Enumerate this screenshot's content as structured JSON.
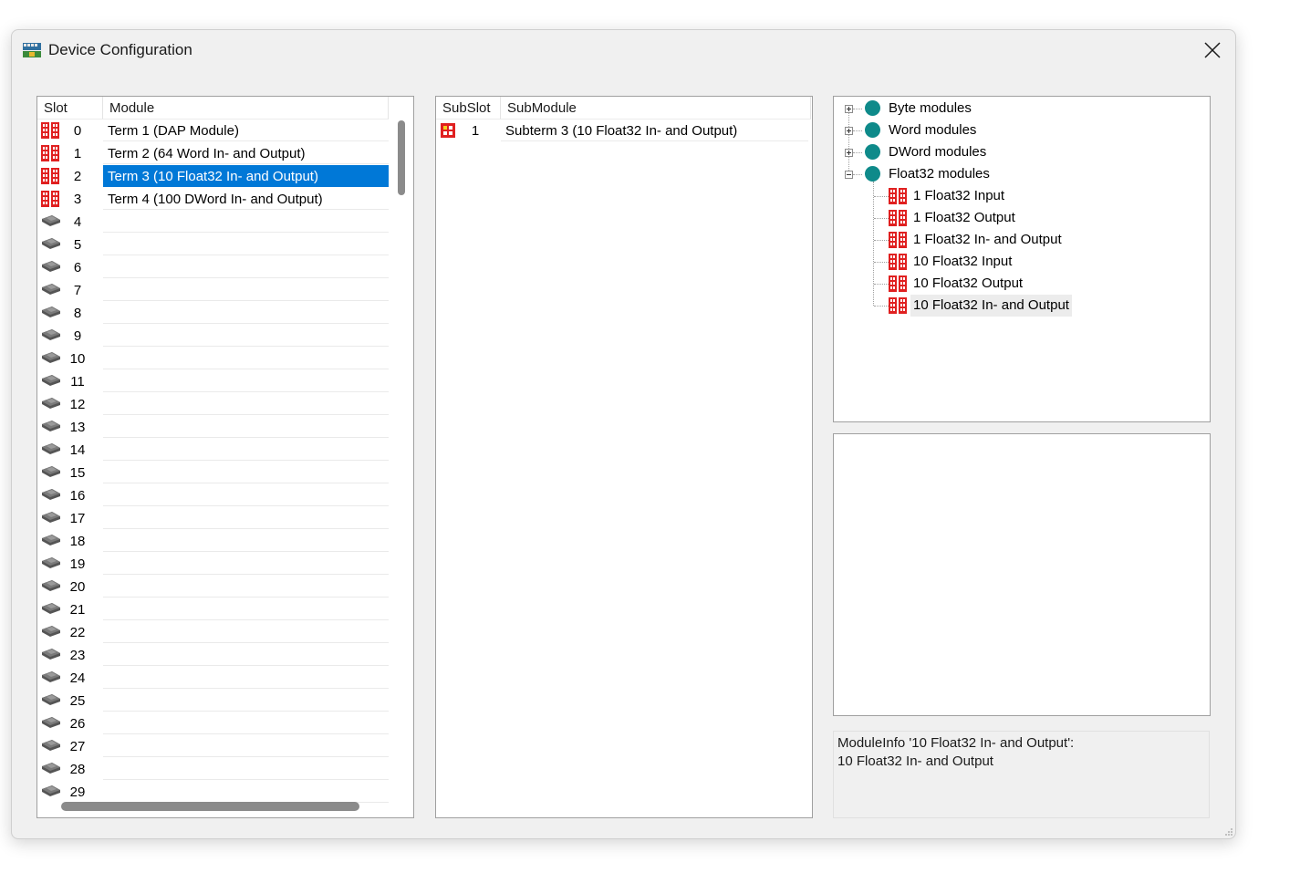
{
  "window": {
    "title": "Device Configuration"
  },
  "colors": {
    "accent": "#0078d7",
    "module_red": "#e02020",
    "tree_dot": "#0e8a8a"
  },
  "slot_table": {
    "headers": {
      "slot": "Slot",
      "module": "Module"
    },
    "rows": [
      {
        "slot": "0",
        "module": "Term 1 (DAP Module)",
        "icon": "module-red-icon"
      },
      {
        "slot": "1",
        "module": "Term 2 (64 Word In- and Output)",
        "icon": "module-red-icon"
      },
      {
        "slot": "2",
        "module": "Term 3 (10 Float32 In- and Output)",
        "icon": "module-red-icon",
        "selected": true
      },
      {
        "slot": "3",
        "module": "Term 4 (100 DWord In- and Output)",
        "icon": "module-red-icon"
      },
      {
        "slot": "4",
        "module": "",
        "icon": "empty-slot-icon"
      },
      {
        "slot": "5",
        "module": "",
        "icon": "empty-slot-icon"
      },
      {
        "slot": "6",
        "module": "",
        "icon": "empty-slot-icon"
      },
      {
        "slot": "7",
        "module": "",
        "icon": "empty-slot-icon"
      },
      {
        "slot": "8",
        "module": "",
        "icon": "empty-slot-icon"
      },
      {
        "slot": "9",
        "module": "",
        "icon": "empty-slot-icon"
      },
      {
        "slot": "10",
        "module": "",
        "icon": "empty-slot-icon"
      },
      {
        "slot": "11",
        "module": "",
        "icon": "empty-slot-icon"
      },
      {
        "slot": "12",
        "module": "",
        "icon": "empty-slot-icon"
      },
      {
        "slot": "13",
        "module": "",
        "icon": "empty-slot-icon"
      },
      {
        "slot": "14",
        "module": "",
        "icon": "empty-slot-icon"
      },
      {
        "slot": "15",
        "module": "",
        "icon": "empty-slot-icon"
      },
      {
        "slot": "16",
        "module": "",
        "icon": "empty-slot-icon"
      },
      {
        "slot": "17",
        "module": "",
        "icon": "empty-slot-icon"
      },
      {
        "slot": "18",
        "module": "",
        "icon": "empty-slot-icon"
      },
      {
        "slot": "19",
        "module": "",
        "icon": "empty-slot-icon"
      },
      {
        "slot": "20",
        "module": "",
        "icon": "empty-slot-icon"
      },
      {
        "slot": "21",
        "module": "",
        "icon": "empty-slot-icon"
      },
      {
        "slot": "22",
        "module": "",
        "icon": "empty-slot-icon"
      },
      {
        "slot": "23",
        "module": "",
        "icon": "empty-slot-icon"
      },
      {
        "slot": "24",
        "module": "",
        "icon": "empty-slot-icon"
      },
      {
        "slot": "25",
        "module": "",
        "icon": "empty-slot-icon"
      },
      {
        "slot": "26",
        "module": "",
        "icon": "empty-slot-icon"
      },
      {
        "slot": "27",
        "module": "",
        "icon": "empty-slot-icon"
      },
      {
        "slot": "28",
        "module": "",
        "icon": "empty-slot-icon"
      },
      {
        "slot": "29",
        "module": "",
        "icon": "empty-slot-icon"
      }
    ]
  },
  "subslot_table": {
    "headers": {
      "subslot": "SubSlot",
      "submodule": "SubModule"
    },
    "rows": [
      {
        "subslot": "1",
        "submodule": "Subterm 3 (10 Float32 In- and Output)",
        "icon": "submodule-icon"
      }
    ]
  },
  "catalog_tree": {
    "groups": [
      {
        "label": "Byte modules",
        "expanded": false
      },
      {
        "label": "Word modules",
        "expanded": false
      },
      {
        "label": "DWord modules",
        "expanded": false
      },
      {
        "label": "Float32 modules",
        "expanded": true
      }
    ],
    "children": [
      {
        "label": "1 Float32 Input"
      },
      {
        "label": "1 Float32 Output"
      },
      {
        "label": "1 Float32 In- and Output"
      },
      {
        "label": "10 Float32 Input"
      },
      {
        "label": "10 Float32 Output"
      },
      {
        "label": "10 Float32 In- and Output",
        "highlighted": true
      }
    ]
  },
  "module_info": {
    "line1": "ModuleInfo '10 Float32 In- and Output':",
    "line2": "10 Float32 In- and Output"
  }
}
